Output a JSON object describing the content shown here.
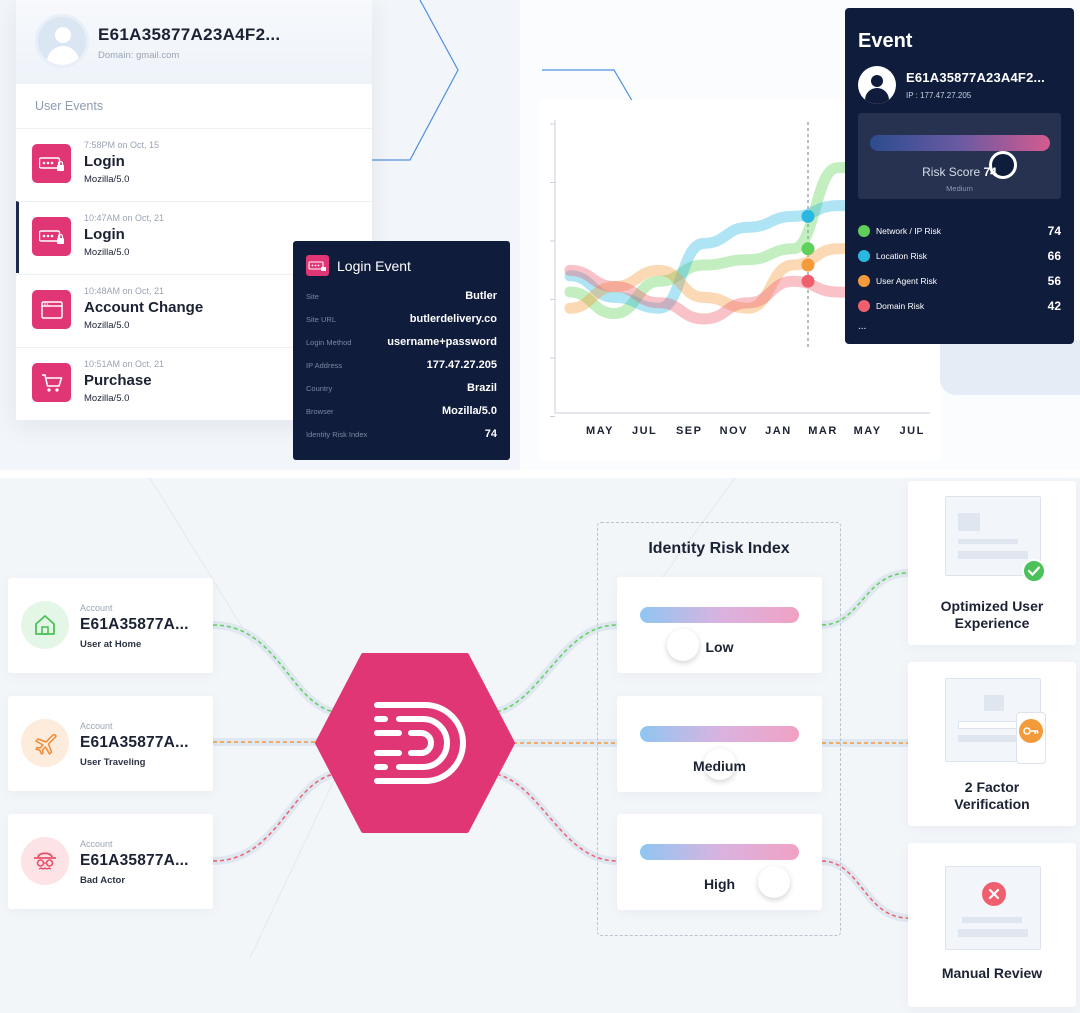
{
  "user_panel": {
    "user_id": "E61A35877A23A4F2...",
    "domain": "Domain: gmail.com",
    "events_title": "User Events",
    "events": [
      {
        "time": "7:58PM on Oct, 15",
        "name": "Login",
        "agent": "Mozilla/5.0",
        "icon": "password-icon"
      },
      {
        "time": "10:47AM on Oct, 21",
        "name": "Login",
        "agent": "Mozilla/5.0",
        "icon": "password-icon"
      },
      {
        "time": "10:48AM on Oct, 21",
        "name": "Account Change",
        "agent": "Mozilla/5.0",
        "icon": "browser-window-icon"
      },
      {
        "time": "10:51AM on Oct, 21",
        "name": "Purchase",
        "agent": "Mozilla/5.0",
        "icon": "cart-icon"
      }
    ]
  },
  "login_event": {
    "title": "Login Event",
    "fields": [
      {
        "key": "Site",
        "value": "Butler"
      },
      {
        "key": "Site URL",
        "value": "butlerdelivery.co"
      },
      {
        "key": "Login Method",
        "value": "username+password"
      },
      {
        "key": "IP Address",
        "value": "177.47.27.205"
      },
      {
        "key": "Country",
        "value": "Brazil"
      },
      {
        "key": "Browser",
        "value": "Mozilla/5.0"
      },
      {
        "key": "Identity Risk Index",
        "value": "74"
      }
    ]
  },
  "chart_data": {
    "type": "line",
    "categories": [
      "MAY",
      "JUL",
      "SEP",
      "NOV",
      "JAN",
      "MAR",
      "MAY",
      "JUL"
    ],
    "series": [
      {
        "color": "#5fd15a",
        "values": [
          3.0,
          2.6,
          3.2,
          3.5,
          3.6,
          3.8,
          5.3,
          5.5
        ]
      },
      {
        "color": "#2ab7e0",
        "values": [
          3.3,
          2.9,
          2.7,
          3.9,
          4.2,
          4.4,
          4.6,
          4.6
        ]
      },
      {
        "color": "#f39a3a",
        "values": [
          2.7,
          3.1,
          3.4,
          2.9,
          2.7,
          3.5,
          3.8,
          3.9
        ]
      },
      {
        "color": "#ef5f6e",
        "values": [
          3.4,
          3.1,
          2.8,
          2.5,
          2.8,
          3.2,
          3.0,
          2.9
        ]
      }
    ],
    "highlight_category": "MAR",
    "ylim": [
      1,
      6
    ],
    "grid": false
  },
  "event_panel": {
    "title": "Event",
    "user_id": "E61A35877A23A4F2...",
    "ip": "IP : 177.47.27.205",
    "risk_score_label": "Risk Score",
    "risk_score": "74",
    "risk_fraction": 0.74,
    "risk_level": "Medium",
    "factors": [
      {
        "label": "Network / IP Risk",
        "value": "74",
        "color": "#5fd15a"
      },
      {
        "label": "Location Risk",
        "value": "66",
        "color": "#2ab7e0"
      },
      {
        "label": "User Agent Risk",
        "value": "56",
        "color": "#f39a3a"
      },
      {
        "label": "Domain Risk",
        "value": "42",
        "color": "#ef5f6e"
      }
    ],
    "more": "..."
  },
  "accounts": [
    {
      "label": "Account",
      "id": "E61A35877A...",
      "desc": "User at Home",
      "icon": "home-icon",
      "bg": "#e4f6e5",
      "color": "#4cc159"
    },
    {
      "label": "Account",
      "id": "E61A35877A...",
      "desc": "User Traveling",
      "icon": "airplane-icon",
      "bg": "#fdebdc",
      "color": "#f08a34"
    },
    {
      "label": "Account",
      "id": "E61A35877A...",
      "desc": "Bad Actor",
      "icon": "spy-icon",
      "bg": "#fde2e6",
      "color": "#ec4f6a"
    }
  ],
  "risk_index": {
    "title": "Identity Risk Index",
    "levels": [
      {
        "label": "Low",
        "fraction": 0.27
      },
      {
        "label": "Medium",
        "fraction": 0.5
      },
      {
        "label": "High",
        "fraction": 0.84
      }
    ]
  },
  "outcomes": [
    {
      "label_line1": "Optimized User",
      "label_line2": "Experience"
    },
    {
      "label_line1": "2 Factor",
      "label_line2": "Verification"
    },
    {
      "label_line1": "Manual Review",
      "label_line2": ""
    }
  ],
  "colors": {
    "brand_pink": "#e03675",
    "navy": "#101c3b",
    "green": "#5fd15a",
    "orange": "#f39a3a",
    "red": "#ef5f6e",
    "blue": "#2ab7e0"
  }
}
